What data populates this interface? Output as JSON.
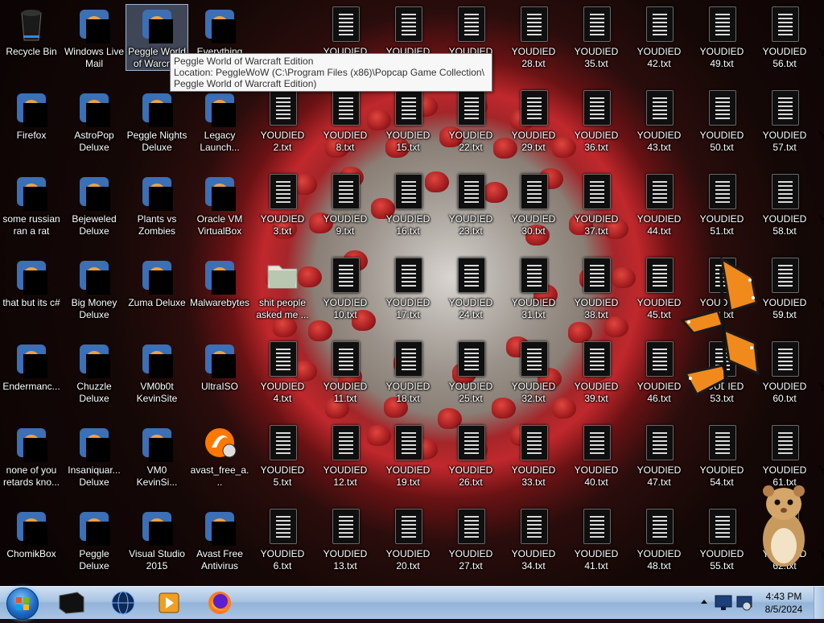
{
  "desktop": {
    "left_icons": [
      {
        "label": "Recycle Bin",
        "icon": "recycle-bin-icon",
        "covered": false
      },
      {
        "label": "Windows Live\nMail",
        "icon": "windows-live-mail-icon",
        "covered": true
      },
      {
        "label": "Peggle World\nof Warcraft",
        "icon": "peggle-wow-icon",
        "covered": true,
        "selected": true
      },
      {
        "label": "Everything",
        "icon": "everything-search-icon",
        "covered": true
      },
      {
        "label": "Firefox",
        "icon": "firefox-icon",
        "covered": true
      },
      {
        "label": "AstroPop\nDeluxe",
        "icon": "astropop-icon",
        "covered": true
      },
      {
        "label": "Peggle Nights\nDeluxe",
        "icon": "peggle-nights-icon",
        "covered": true
      },
      {
        "label": "Legacy\nLaunch...",
        "icon": "minecraft-launcher-icon",
        "covered": true
      },
      {
        "label": "some russian\nran a rat",
        "icon": "lyrics-app-icon",
        "covered": true
      },
      {
        "label": "Bejeweled\nDeluxe",
        "icon": "bejeweled-icon",
        "covered": true
      },
      {
        "label": "Plants vs\nZombies",
        "icon": "plants-vs-zombies-icon",
        "covered": true
      },
      {
        "label": "Oracle VM\nVirtualBox",
        "icon": "virtualbox-icon",
        "covered": true
      },
      {
        "label": "that but its c#",
        "icon": "stacked-windows-icon",
        "covered": true
      },
      {
        "label": "Big Money\nDeluxe",
        "icon": "big-money-icon",
        "covered": true
      },
      {
        "label": "Zuma Deluxe",
        "icon": "zuma-icon",
        "covered": true
      },
      {
        "label": "Malwarebytes",
        "icon": "malwarebytes-icon",
        "covered": true
      },
      {
        "label": "Endermanc...",
        "icon": "monitor-shortcut-icon",
        "covered": true
      },
      {
        "label": "Chuzzle\nDeluxe",
        "icon": "chuzzle-icon",
        "covered": true
      },
      {
        "label": "VM0b0t\nKevinSite",
        "icon": "vm-shortcut-icon",
        "covered": true
      },
      {
        "label": "UltraISO",
        "icon": "ultraiso-icon",
        "covered": true
      },
      {
        "label": "none of you\nretards kno...",
        "icon": "app-shortcut-icon",
        "covered": true
      },
      {
        "label": "Insaniquar...\nDeluxe",
        "icon": "insaniquarium-icon",
        "covered": true
      },
      {
        "label": "VM0\nKevinSi...",
        "icon": "vm-shortcut-icon",
        "covered": true
      },
      {
        "label": "avast_free_a...",
        "icon": "avast-installer-icon",
        "covered": false
      },
      {
        "label": "ChomikBox",
        "icon": "chomikbox-icon",
        "covered": true
      },
      {
        "label": "Peggle Deluxe",
        "icon": "peggle-icon",
        "covered": true
      },
      {
        "label": "Visual Studio\n2015",
        "icon": "visual-studio-icon",
        "covered": true
      },
      {
        "label": "Avast Free\nAntivirus",
        "icon": "avast-icon",
        "covered": true
      },
      {
        "label": "shit people\nasked me ...",
        "icon": "folder-icon",
        "covered": false
      }
    ],
    "txt_columns": [
      [
        "",
        "YOUDIED\n2.txt",
        "YOUDIED\n3.txt",
        "",
        "YOUDIED\n4.txt",
        "YOUDIED\n5.txt",
        "YOUDIED\n6.txt"
      ],
      [
        "YOUDIED",
        "YOUDIED\n8.txt",
        "YOUDIED\n9.txt",
        "YOUDIED\n10.txt",
        "YOUDIED\n11.txt",
        "YOUDIED\n12.txt",
        "YOUDIED\n13.txt"
      ],
      [
        "YOUDIED",
        "YOUDIED\n15.txt",
        "YOUDIED\n16.txt",
        "YOUDIED\n17.txt",
        "YOUDIED\n18.txt",
        "YOUDIED\n19.txt",
        "YOUDIED\n20.txt"
      ],
      [
        "YOUDIED",
        "YOUDIED\n22.txt",
        "YOUDIED\n23.txt",
        "YOUDIED\n24.txt",
        "YOUDIED\n25.txt",
        "YOUDIED\n26.txt",
        "YOUDIED\n27.txt"
      ],
      [
        "YOUDIED\n28.txt",
        "YOUDIED\n29.txt",
        "YOUDIED\n30.txt",
        "YOUDIED\n31.txt",
        "YOUDIED\n32.txt",
        "YOUDIED\n33.txt",
        "YOUDIED\n34.txt"
      ],
      [
        "YOUDIED\n35.txt",
        "YOUDIED\n36.txt",
        "YOUDIED\n37.txt",
        "YOUDIED\n38.txt",
        "YOUDIED\n39.txt",
        "YOUDIED\n40.txt",
        "YOUDIED\n41.txt"
      ],
      [
        "YOUDIED\n42.txt",
        "YOUDIED\n43.txt",
        "YOUDIED\n44.txt",
        "YOUDIED\n45.txt",
        "YOUDIED\n46.txt",
        "YOUDIED\n47.txt",
        "YOUDIED\n48.txt"
      ],
      [
        "YOUDIED\n49.txt",
        "YOUDIED\n50.txt",
        "YOUDIED\n51.txt",
        "YOUDIED\n52.txt",
        "YOUDIED\n53.txt",
        "YOUDIED\n54.txt",
        "YOUDIED\n55.txt"
      ],
      [
        "YOUDIED\n56.txt",
        "YOUDIED\n57.txt",
        "YOUDIED\n58.txt",
        "YOUDIED\n59.txt",
        "YOUDIED\n60.txt",
        "YOUDIED\n61.txt",
        "YOUDIED\n62.txt"
      ]
    ],
    "edge_labels": [
      "Y",
      "Y",
      "Y",
      "Y",
      "Y",
      "Y",
      "Y"
    ],
    "overlays": {
      "butterfly": "butterfly-icon",
      "hamster": "hamster-icon"
    }
  },
  "tooltip": {
    "line1": "Peggle World of Warcraft Edition",
    "line2": "Location: PeggleWoW (C:\\Program Files (x86)\\Popcap Game Collection\\",
    "line3": "Peggle World of Warcraft Edition)"
  },
  "taskbar": {
    "start_button": "start-orb-icon",
    "pinned": [
      "black-app-icon",
      "globe-icon",
      "media-player-icon",
      "firefox-icon"
    ],
    "tray": [
      "tray-up-arrow-icon",
      "monitor-tray-icon",
      "network-tray-icon"
    ],
    "time": "4:43 PM",
    "date": "8/5/2024"
  },
  "colors": {
    "taskbar": "#a9c4e2",
    "virus_red": "#c0282c",
    "virus_grey": "#9a928a",
    "selection": "#96bef0"
  }
}
